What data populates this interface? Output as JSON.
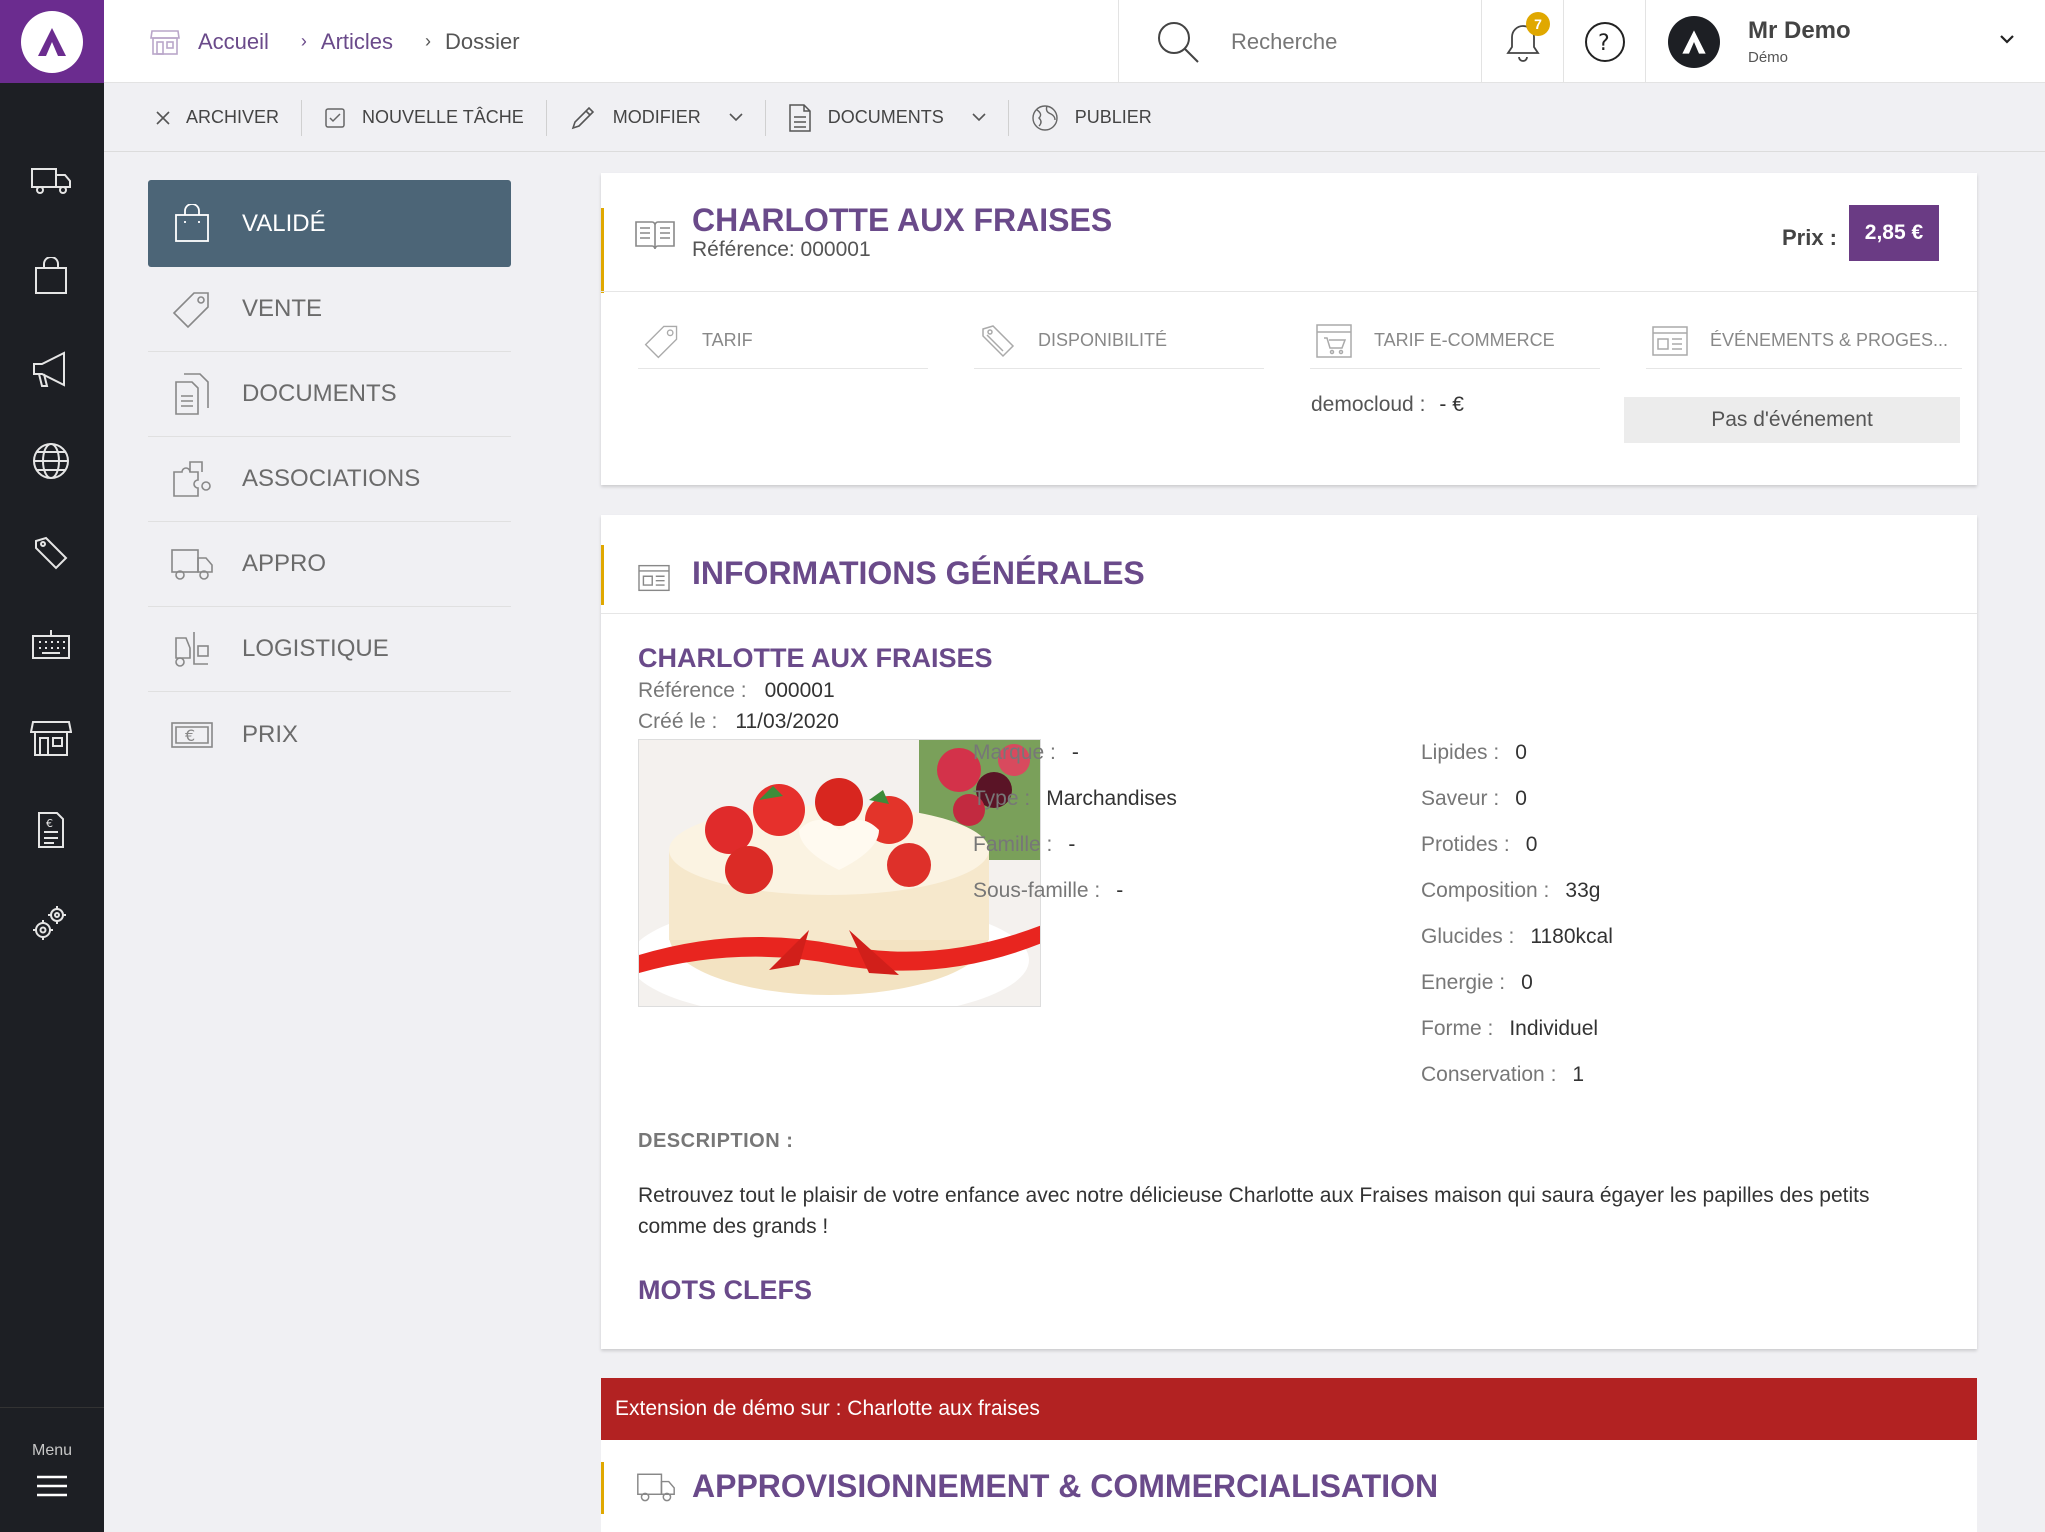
{
  "breadcrumb": {
    "home": "Accueil",
    "articles": "Articles",
    "current": "Dossier"
  },
  "search": {
    "placeholder": "Recherche"
  },
  "notifications": {
    "count": "7"
  },
  "user": {
    "name": "Mr Demo",
    "role": "Démo"
  },
  "sidebar": {
    "menu_label": "Menu",
    "icons": [
      "truck-icon",
      "shopping-bag-icon",
      "megaphone-icon",
      "globe-icon",
      "price-tags-icon",
      "keyboard-icon",
      "store-icon",
      "document-euro-icon",
      "settings-gears-icon"
    ]
  },
  "toolbar": {
    "archive": "ARCHIVER",
    "new_task": "NOUVELLE TÂCHE",
    "edit": "MODIFIER",
    "documents": "DOCUMENTS",
    "publish": "PUBLIER"
  },
  "secnav": {
    "items": [
      {
        "label": "VALIDÉ",
        "icon": "shopping-bag-icon",
        "active": true
      },
      {
        "label": "VENTE",
        "icon": "tag-icon"
      },
      {
        "label": "DOCUMENTS",
        "icon": "documents-icon"
      },
      {
        "label": "ASSOCIATIONS",
        "icon": "puzzle-icon"
      },
      {
        "label": "APPRO",
        "icon": "truck-icon"
      },
      {
        "label": "LOGISTIQUE",
        "icon": "forklift-icon"
      },
      {
        "label": "PRIX",
        "icon": "euro-note-icon"
      }
    ]
  },
  "product_header": {
    "title": "CHARLOTTE AUX FRAISES",
    "reference": "Référence: 000001",
    "price_label": "Prix :",
    "price": "2,85 €"
  },
  "subtabs": {
    "tarif": "TARIF",
    "dispo": "DISPONIBILITÉ",
    "ecommerce": "TARIF E-COMMERCE",
    "events": "ÉVÉNEMENTS & PROGES..."
  },
  "ecommerce": {
    "label": "democloud :",
    "value": "- €"
  },
  "events": {
    "empty": "Pas d'événement"
  },
  "general": {
    "section_title": "INFORMATIONS GÉNÉRALES",
    "name": "CHARLOTTE AUX FRAISES",
    "ref_label": "Référence :",
    "ref_value": "000001",
    "created_label": "Créé le :",
    "created_value": "11/03/2020",
    "attributes_left": [
      {
        "label": "Marque :",
        "value": "-"
      },
      {
        "label": "Type :",
        "value": "Marchandises"
      },
      {
        "label": "Famille :",
        "value": "-"
      },
      {
        "label": "Sous-famille :",
        "value": "-"
      }
    ],
    "attributes_right": [
      {
        "label": "Lipides :",
        "value": "0"
      },
      {
        "label": "Saveur :",
        "value": "0"
      },
      {
        "label": "Protides :",
        "value": "0"
      },
      {
        "label": "Composition :",
        "value": "33g"
      },
      {
        "label": "Glucides :",
        "value": "1180kcal"
      },
      {
        "label": "Energie :",
        "value": "0"
      },
      {
        "label": "Forme :",
        "value": "Individuel"
      },
      {
        "label": "Conservation :",
        "value": "1"
      }
    ],
    "description_label": "DESCRIPTION :",
    "description": "Retrouvez tout le plaisir de votre enfance avec notre délicieuse Charlotte aux Fraises maison qui saura égayer les papilles des petits comme des grands !",
    "keywords_title": "MOTS CLEFS"
  },
  "extension_banner": "Extension de démo sur : Charlotte aux fraises",
  "appro": {
    "section_title": "APPROVISIONNEMENT & COMMERCIALISATION"
  },
  "colors": {
    "brand": "#6b2c8f",
    "title": "#6a4a8a",
    "accent": "#e0a800",
    "active_nav": "#4c6577",
    "banner": "#b22222",
    "sidebar": "#1d1f24"
  }
}
